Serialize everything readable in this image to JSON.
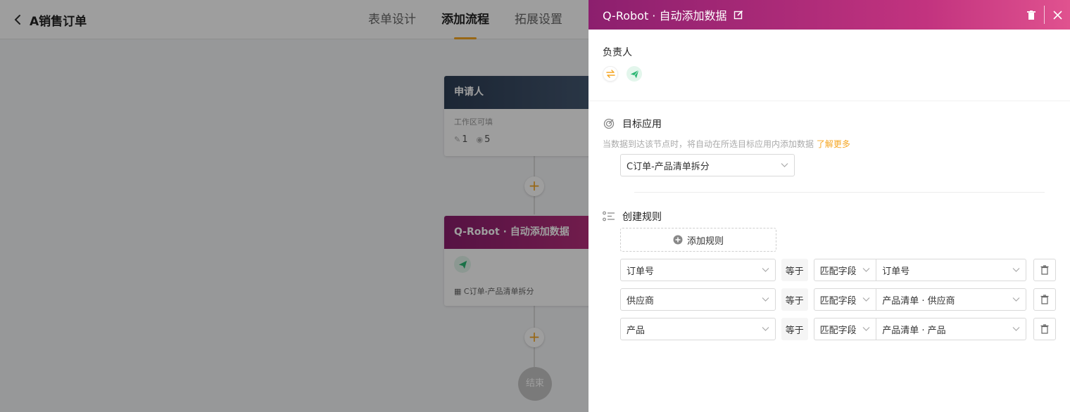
{
  "app": {
    "title": "A销售订单",
    "tabs": [
      "表单设计",
      "添加流程",
      "拓展设置"
    ],
    "active_tab": "添加流程"
  },
  "flow": {
    "applicant_node": {
      "title": "申请人",
      "subtitle": "工作区可填",
      "edit_count": "1",
      "view_count": "5"
    },
    "robot_node": {
      "title": "Q-Robot · 自动添加数据",
      "target_app": "C订单-产品清单拆分"
    },
    "add_symbol": "+",
    "end_label": "结束"
  },
  "panel": {
    "title": "Q-Robot · 自动添加数据",
    "owner_label": "负责人",
    "target_section": {
      "title": "目标应用",
      "hint": "当数据到达该节点时，将自动在所选目标应用内添加数据",
      "learn_more": "了解更多",
      "selected_app": "C订单-产品清单拆分"
    },
    "rules_section": {
      "title": "创建规则",
      "add_button": "添加规则",
      "rules": [
        {
          "field": "订单号",
          "operator": "等于",
          "match_type": "匹配字段",
          "value": "订单号"
        },
        {
          "field": "供应商",
          "operator": "等于",
          "match_type": "匹配字段",
          "value": "产品清单 · 供应商"
        },
        {
          "field": "产品",
          "operator": "等于",
          "match_type": "匹配字段",
          "value": "产品清单 · 产品"
        }
      ]
    }
  },
  "colors": {
    "accent": "#f5a623",
    "robot_gradient_start": "#8c1f6e",
    "robot_gradient_end": "#e0528f",
    "applicant_header": "#2d3e55",
    "send_green": "#2bb673"
  },
  "icons": {
    "back": "chevron-left-icon",
    "edit": "edit-icon",
    "delete": "trash-icon",
    "close": "close-icon",
    "swap": "swap-icon",
    "send": "paper-plane-icon",
    "target": "target-icon",
    "rules": "list-icon",
    "add": "plus-circle-icon"
  }
}
